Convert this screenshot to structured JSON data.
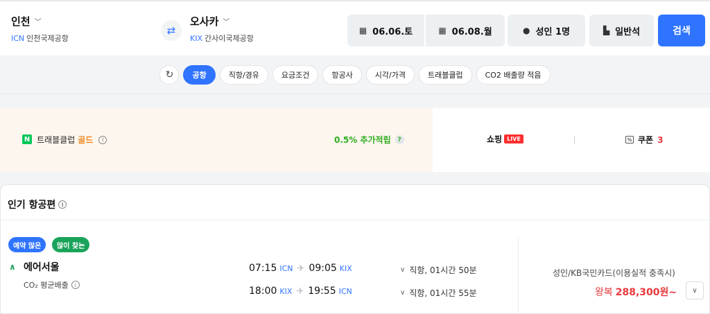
{
  "search": {
    "origin": {
      "city": "인천",
      "code": "ICN",
      "airport": "인천국제공항"
    },
    "destination": {
      "city": "오사카",
      "code": "KIX",
      "airport": "간사이국제공항"
    },
    "depart_date": "06.06.토",
    "return_date": "06.08.월",
    "passengers": "성인 1명",
    "seat_class": "일반석",
    "search_label": "검색"
  },
  "filters": {
    "items": [
      "공항",
      "직항/경유",
      "요금조건",
      "항공사",
      "시각/가격",
      "트래블클럽",
      "CO2 배출량 적음"
    ],
    "active": "공항"
  },
  "promo": {
    "n_badge": "N",
    "club_label": "트래블클럽",
    "club_tier": "골드",
    "extra_points": "0.5% 추가적립",
    "help_mark": "?",
    "shopping_label": "쇼핑",
    "live_label": "LIVE",
    "coupon_label": "쿠폰",
    "coupon_count": "3"
  },
  "popular": {
    "title": "인기 항공편",
    "badges": [
      "예약 많은",
      "많이 찾는"
    ],
    "flight": {
      "airline": "에어서울",
      "co2_label": "CO₂ 평균배출",
      "outbound": {
        "dep_time": "07:15",
        "dep_ap": "ICN",
        "arr_time": "09:05",
        "arr_ap": "KIX",
        "duration": "직항, 01시간 50분"
      },
      "inbound": {
        "dep_time": "18:00",
        "dep_ap": "KIX",
        "arr_time": "19:55",
        "arr_ap": "ICN",
        "duration": "직항, 01시간 55분"
      },
      "card": "성인/KB국민카드(이용실적 충족시)",
      "price_type": "왕복",
      "price": "288,300원~"
    }
  },
  "colors": {
    "accent": "#2f74ff",
    "price": "#e8383d",
    "gold": "#f08a24",
    "green": "#2dad1e"
  }
}
